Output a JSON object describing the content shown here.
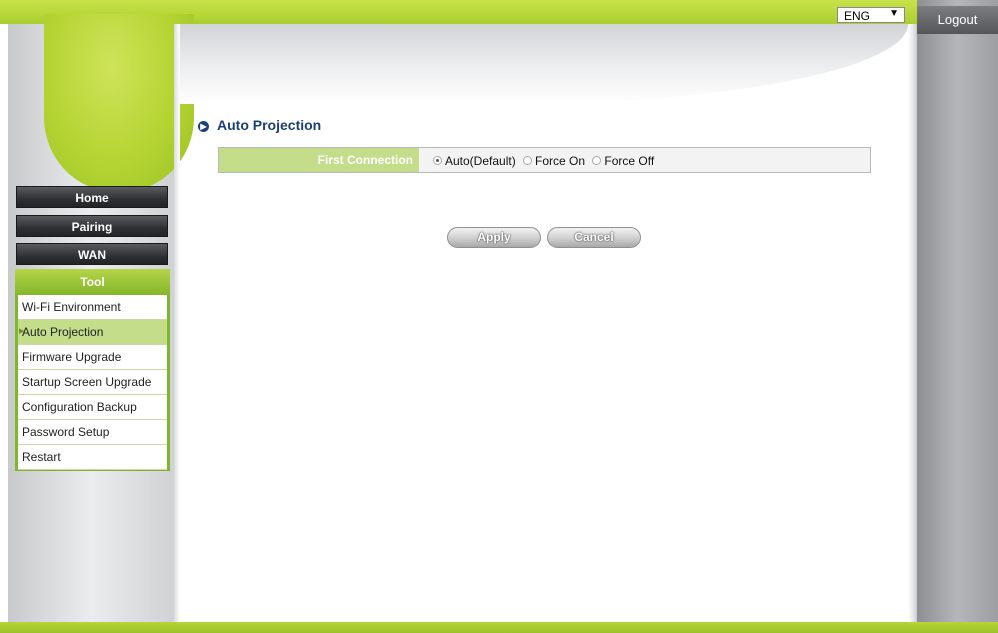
{
  "header": {
    "language": "ENG",
    "language_arrow": "▼",
    "logout_label": "Logout"
  },
  "nav": {
    "home": "Home",
    "pairing": "Pairing",
    "wan": "WAN",
    "tool": "Tool",
    "tool_items": [
      "Wi-Fi Environment",
      "Auto Projection",
      "Firmware Upgrade",
      "Startup Screen Upgrade",
      "Configuration Backup",
      "Password Setup",
      "Restart"
    ],
    "active_index": 1
  },
  "main": {
    "section_title": "Auto Projection",
    "form": {
      "label": "First Connection",
      "options": [
        "Auto(Default)",
        "Force On",
        "Force Off"
      ],
      "selected": "Auto(Default)"
    },
    "apply_label": "Apply",
    "cancel_label": "Cancel"
  },
  "colors": {
    "brand_green": "#a9cf2f",
    "title_blue": "#1c3f78",
    "label_green": "#c4dd8a"
  }
}
